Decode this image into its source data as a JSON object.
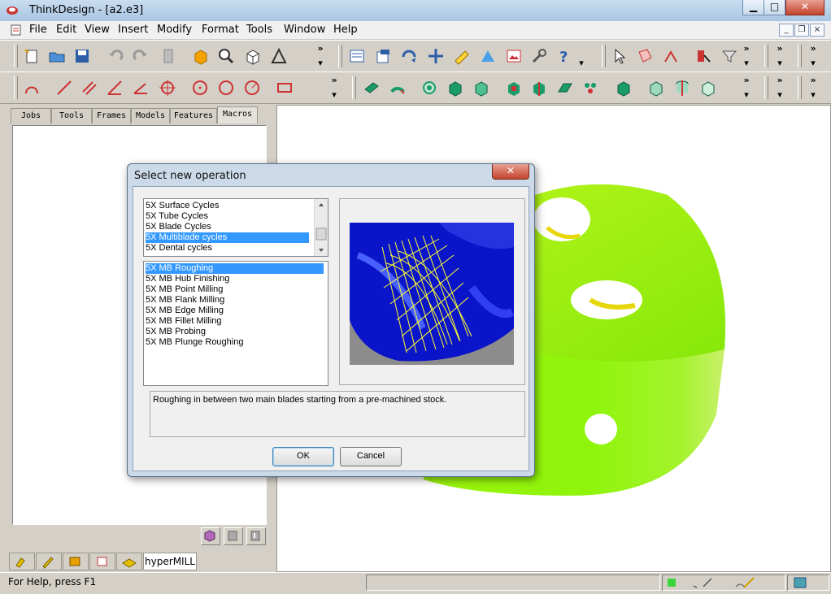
{
  "window": {
    "title": "ThinkDesign - [a2.e3]",
    "min": "▁",
    "max": "□",
    "close": "✕"
  },
  "menu": [
    "File",
    "Edit",
    "View",
    "Insert",
    "Modify",
    "Format",
    "Tools",
    "Window",
    "Help"
  ],
  "mdi_controls": {
    "min": "_",
    "restore": "❐",
    "close": "×"
  },
  "left_panel": {
    "tabs": [
      "Jobs",
      "Tools",
      "Frames",
      "Models",
      "Features",
      "Macros"
    ],
    "bottom_tab_label": "hyperMILL"
  },
  "toolbar_chevron": "»",
  "toolbar_dropdown": "▾",
  "status": {
    "help_text": "For Help, press F1"
  },
  "dialog": {
    "title": "Select new operation",
    "close": "✕",
    "categories": [
      "5X Surface Cycles",
      "5X Tube Cycles",
      "5X Blade Cycles",
      "5X Multiblade cycles",
      "5X Dental cycles"
    ],
    "selected_category": "5X Multiblade cycles",
    "operations": [
      "5X MB Roughing",
      "5X MB Hub Finishing",
      "5X MB Point Milling",
      "5X MB Flank Milling",
      "5X MB Edge Milling",
      "5X MB Fillet Milling",
      "5X MB Probing",
      "5X MB Plunge Roughing"
    ],
    "selected_operation": "5X MB Roughing",
    "description": "Roughing in between two main blades starting from a pre-machined stock.",
    "ok": "OK",
    "cancel": "Cancel"
  },
  "colors": {
    "selection": "#3399ff",
    "part": "#8df50a",
    "preview_blue": "#0a14c8",
    "toolpath": "#ffff33"
  }
}
